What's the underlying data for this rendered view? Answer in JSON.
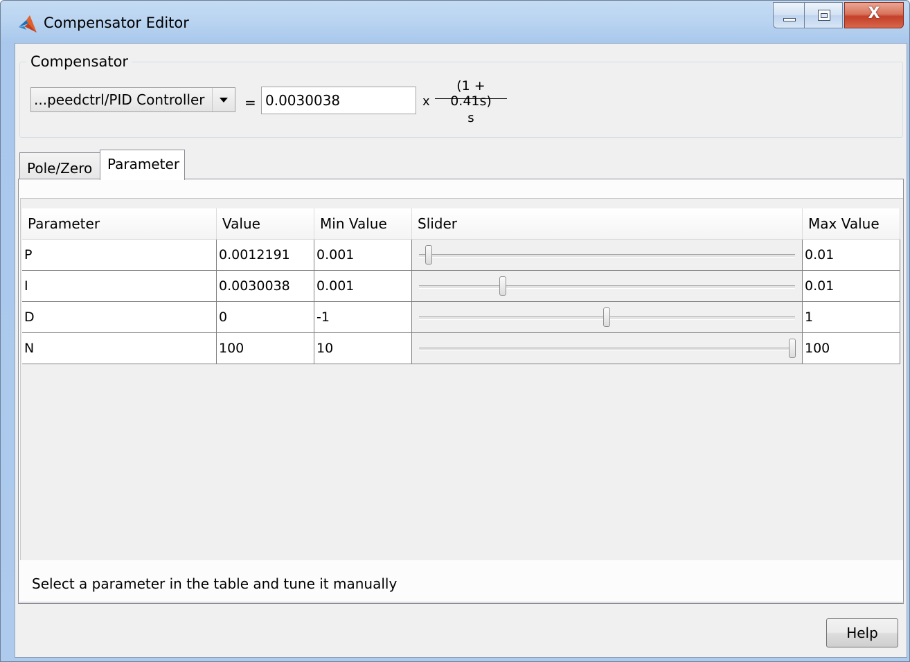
{
  "window": {
    "title": "Compensator Editor",
    "controls": {
      "minimize": "minimize-icon",
      "maximize": "restore-icon",
      "close": "X"
    }
  },
  "compensator": {
    "group_label": "Compensator",
    "selected_block": "...peedctrl/PID Controller",
    "equals": "=",
    "gain_value": "0.0030038",
    "times": "x",
    "numerator": "(1 + 0.41s)",
    "denominator": "s"
  },
  "tabs": [
    {
      "label": "Pole/Zero",
      "active": false
    },
    {
      "label": "Parameter",
      "active": true
    }
  ],
  "table": {
    "columns": [
      "Parameter",
      "Value",
      "Min Value",
      "Slider",
      "Max Value"
    ],
    "rows": [
      {
        "parameter": "P",
        "value": "0.0012191",
        "min": "0.001",
        "max": "0.01",
        "slider_fraction": 0.02
      },
      {
        "parameter": "I",
        "value": "0.0030038",
        "min": "0.001",
        "max": "0.01",
        "slider_fraction": 0.22
      },
      {
        "parameter": "D",
        "value": "0",
        "min": "-1",
        "max": "1",
        "slider_fraction": 0.5
      },
      {
        "parameter": "N",
        "value": "100",
        "min": "10",
        "max": "100",
        "slider_fraction": 1.0
      }
    ]
  },
  "status_text": "Select a parameter in the table and tune it manually",
  "help_label": "Help",
  "colors": {
    "titlebar": "#b9d4f1",
    "close_button": "#c4402a",
    "panel": "#f0f0f0"
  }
}
